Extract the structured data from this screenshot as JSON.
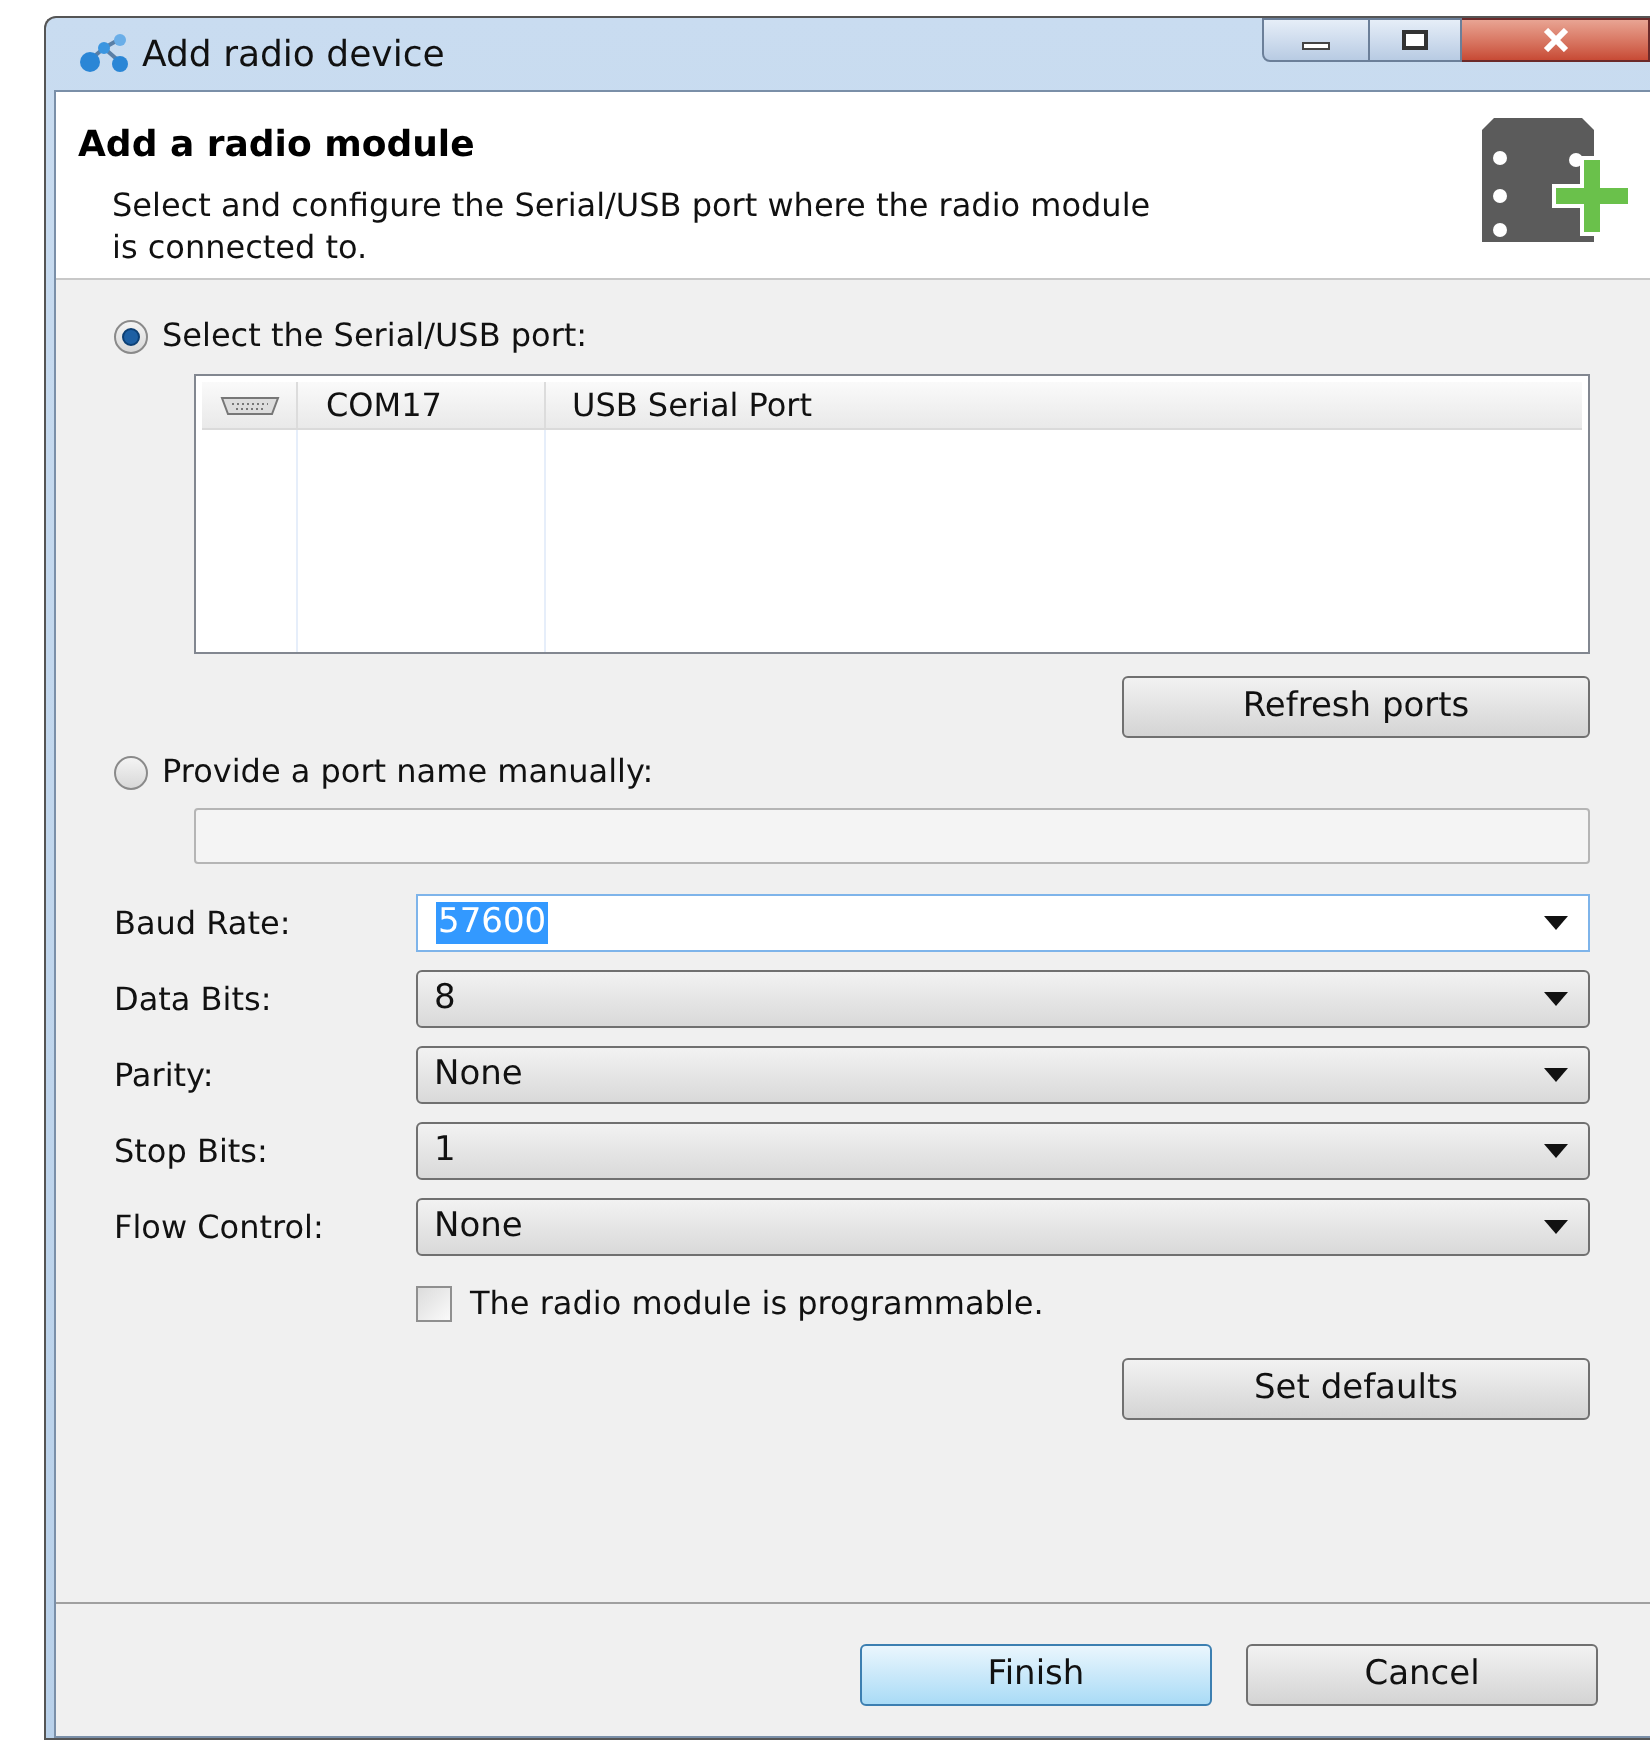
{
  "window": {
    "title": "Add radio device"
  },
  "header": {
    "title": "Add a radio module",
    "description": "Select and configure the Serial/USB port where the radio module is connected to."
  },
  "port_sources": [
    {
      "kind": "list",
      "label": "Select the Serial/USB port:",
      "selected": true
    },
    {
      "kind": "manual",
      "label": "Provide a port name manually:",
      "selected": false
    }
  ],
  "port_table": {
    "rows": [
      {
        "port": "COM17",
        "description": "USB Serial Port"
      }
    ]
  },
  "refresh_button": "Refresh ports",
  "settings": [
    {
      "kind": "editable",
      "label": "Baud Rate:",
      "value": "57600"
    },
    {
      "kind": "dropdown",
      "label": "Data Bits:",
      "value": "8"
    },
    {
      "kind": "dropdown",
      "label": "Parity:",
      "value": "None"
    },
    {
      "kind": "dropdown",
      "label": "Stop Bits:",
      "value": "1"
    },
    {
      "kind": "dropdown",
      "label": "Flow Control:",
      "value": "None"
    }
  ],
  "programmable": {
    "label": "The radio module is programmable.",
    "checked": false
  },
  "set_defaults_button": "Set defaults",
  "footer_buttons": [
    {
      "label": "Finish",
      "default": true
    },
    {
      "label": "Cancel",
      "default": false
    }
  ]
}
